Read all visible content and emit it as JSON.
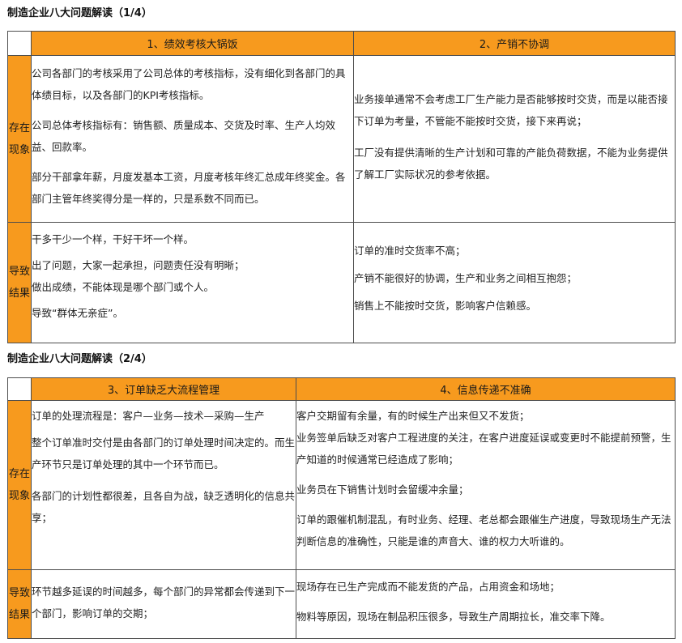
{
  "sections": [
    {
      "title": "制造企业八大问题解读（1/4）",
      "headers": [
        "1、绩效考核大锅饭",
        "2、产销不协调"
      ],
      "rows": [
        {
          "label": "存在现象",
          "left": [
            "公司各部门的考核采用了公司总体的考核指标，没有细化到各部门的具体绩目标，以及各部门的KPI考核指标。",
            "公司总体考核指标有：销售额、质量成本、交货及时率、生产人均效益、回款率。",
            "部分干部拿年薪，月度发基本工资，月度考核年终汇总成年终奖金。各部门主管年终奖得分是一样的，只是系数不同而已。"
          ],
          "right": [
            "业务接单通常不会考虑工厂生产能力是否能够按时交货，而是以能否接下订单为考量，不管能不能按时交货，接下来再说；",
            "工厂没有提供清晰的生产计划和可靠的产能负荷数据，不能为业务提供了解工厂实际状况的参考依据。"
          ]
        },
        {
          "label": "导致结果",
          "left": [
            "干多干少一个样，干好干坏一个样。",
            "出了问题，大家一起承担，问题责任没有明晰；",
            "做出成绩，不能体现是哪个部门或个人。",
            "导致“群体无亲症”。"
          ],
          "right": [
            "订单的准时交货率不高；",
            "产销不能很好的协调，生产和业务之间相互抱怨；",
            "销售上不能按时交货，影响客户信赖感。"
          ]
        }
      ]
    },
    {
      "title": "制造企业八大问题解读（2/4）",
      "headers": [
        "3、订单缺乏大流程管理",
        "4、信息传递不准确"
      ],
      "rows": [
        {
          "label": "存在现象",
          "left": [
            "订单的处理流程是：客户—业务—技术—采购—生产",
            "整个订单准时交付是由各部门的订单处理时间决定的。而生产环节只是订单处理的其中一个环节而已。",
            "各部门的计划性都很差，且各自为战，缺乏透明化的信息共享；"
          ],
          "right": [
            "客户交期留有余量，有的时候生产出来但又不发货；",
            "业务签单后缺乏对客户工程进度的关注，在客户进度延误或变更时不能提前预警，生产知道的时候通常已经造成了影响；",
            "业务员在下销售计划时会留缓冲余量；",
            "订单的跟催机制混乱，有时业务、经理、老总都会跟催生产进度，导致现场生产无法判断信息的准确性，只能是谁的声音大、谁的权力大听谁的。"
          ]
        },
        {
          "label": "导致结果",
          "left": [
            "环节越多延误的时间越多，每个部门的异常都会传递到下一个部门，影响订单的交期；"
          ],
          "right": [
            "现场存在已生产完成而不能发货的产品，占用资金和场地；",
            "物料等原因，现场在制品积压很多，导致生产周期拉长，准交率下降。"
          ]
        }
      ]
    }
  ]
}
